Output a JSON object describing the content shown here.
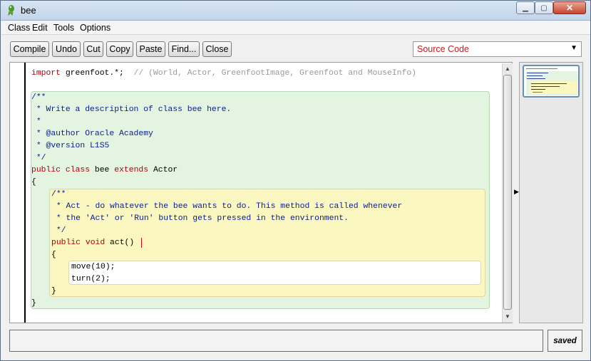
{
  "window": {
    "title": "bee"
  },
  "menu": [
    "Class",
    "Edit",
    "Tools",
    "Options"
  ],
  "toolbar": {
    "compile": "Compile",
    "undo": "Undo",
    "cut": "Cut",
    "copy": "Copy",
    "paste": "Paste",
    "find": "Find...",
    "close": "Close",
    "view_select": "Source Code"
  },
  "code": {
    "line1_import": "import",
    "line1_rest": " greenfoot.*;",
    "line1_comment": "  // (World, Actor, GreenfootImage, Greenfoot and MouseInfo)",
    "doc_open": "/**",
    "doc_desc": " * Write a description of class bee here.",
    "doc_star": " *",
    "doc_author": " * @author Oracle Academy",
    "doc_version": " * @version L1S5",
    "doc_close": " */",
    "class_public": "public",
    "class_class": "class",
    "class_name": "bee",
    "class_extends": "extends",
    "class_super": "Actor",
    "brace_open": "{",
    "mdoc_open": "/**",
    "mdoc_line1": " * Act - do whatever the bee wants to do. This method is called whenever",
    "mdoc_line2": " * the 'Act' or 'Run' button gets pressed in the environment.",
    "mdoc_close": " */",
    "method_public": "public",
    "method_void": "void",
    "method_name": "act()",
    "method_brace_open": "{",
    "stmt1": "move(10);",
    "stmt2": "turn(2);",
    "method_brace_close": "}",
    "brace_close": "}"
  },
  "status": {
    "message": "",
    "saved": "saved"
  },
  "colors": {
    "keyword": "#b0000f",
    "comment": "#0a1c8f",
    "class_scope": "#e3f5e1",
    "method_scope": "#fbf7c0",
    "select_text": "#c21d1d"
  },
  "icons": [
    "greenfoot-app-icon",
    "minimize-icon",
    "maximize-icon",
    "close-icon",
    "dropdown-arrow-icon",
    "scroll-up-icon",
    "scroll-down-icon",
    "splitter-arrow-icon"
  ]
}
